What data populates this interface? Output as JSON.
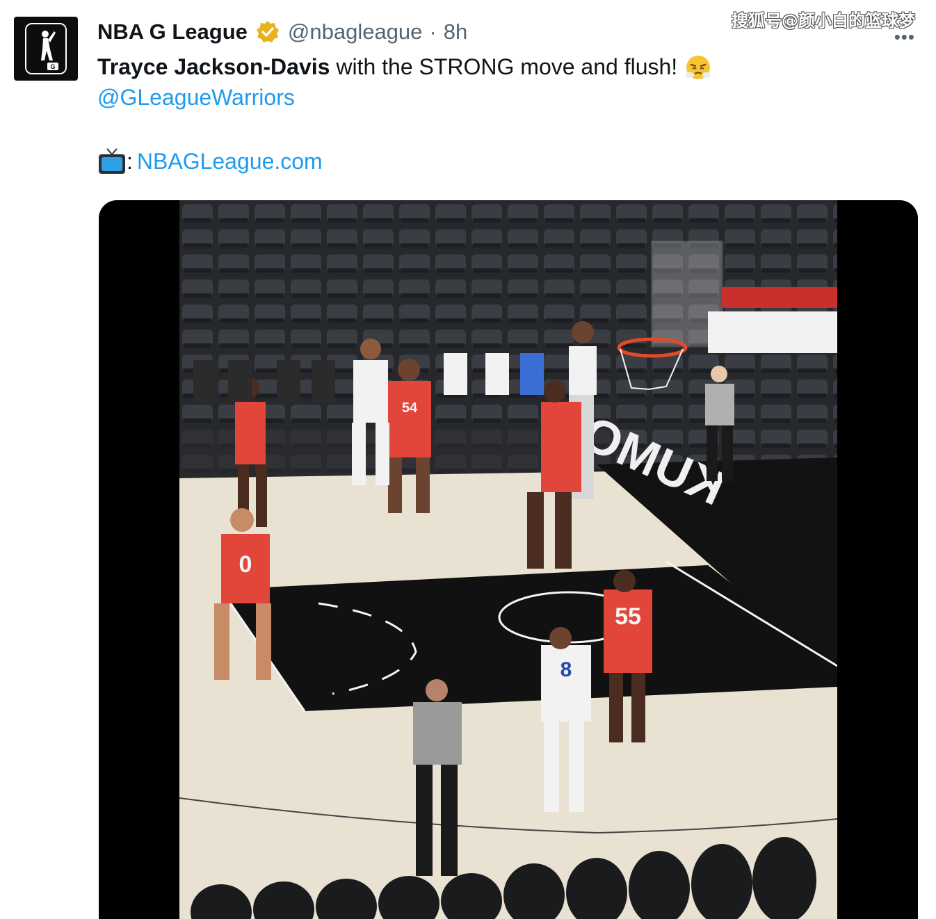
{
  "account": {
    "display_name": "NBA G League",
    "handle": "@nbagleague",
    "separator": "·",
    "time": "8h",
    "verified": true,
    "avatar_icon": "g-league-logo-icon"
  },
  "tweet": {
    "bold_name": "Trayce Jackson-Davis",
    "text_rest": " with the STRONG move and flush!",
    "emoji": "face-with-steam-emoji",
    "mention": "@GLeagueWarriors",
    "tv_icon": "tv-icon",
    "tv_sep": ":",
    "link": "NBAGLeague.com"
  },
  "watermark": "搜狐号@颜小白的篮球梦",
  "more_menu": "•••",
  "media": {
    "type": "video",
    "court_brand": "Kumo",
    "jersey_numbers": [
      "55",
      "8",
      "0",
      "54"
    ],
    "colors": {
      "link": "#1d9bf0",
      "verified": "#e8b21c",
      "court_floor": "#e9e2d3",
      "paint": "#111111",
      "red_jersey": "#e2453a",
      "white_jersey": "#f2f2f2"
    }
  }
}
